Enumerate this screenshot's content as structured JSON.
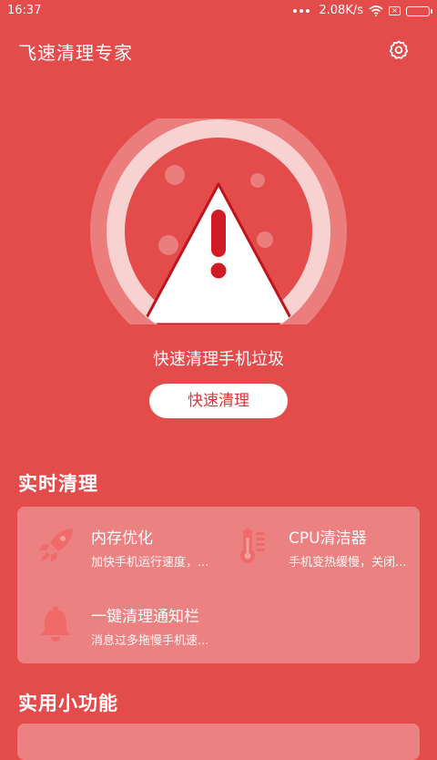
{
  "status_bar": {
    "time": "16:37",
    "network_speed": "2.08K/s"
  },
  "header": {
    "title": "飞速清理专家"
  },
  "gauge": {
    "status": "warning"
  },
  "main": {
    "hint": "快速清理手机垃圾",
    "clean_button": "快速清理"
  },
  "realtime": {
    "title": "实时清理",
    "items": [
      {
        "title": "内存优化",
        "desc": "加快手机运行速度，...",
        "icon": "rocket-icon"
      },
      {
        "title": "CPU清洁器",
        "desc": "手机变热缓慢，关闭...",
        "icon": "thermometer-icon"
      },
      {
        "title": "一键清理通知栏",
        "desc": "消息过多拖慢手机速...",
        "icon": "bell-icon"
      }
    ]
  },
  "tools": {
    "title": "实用小功能"
  },
  "colors": {
    "background": "#e44b4b",
    "accent": "#d01c24",
    "icon": "#f06a6a"
  }
}
